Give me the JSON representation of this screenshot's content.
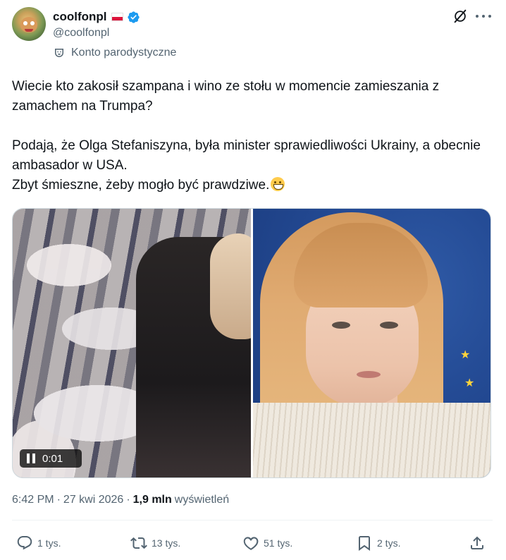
{
  "author": {
    "display_name": "coolfonpl",
    "handle": "@coolfonpl",
    "label": "Konto parodystyczne",
    "flag": "poland-flag",
    "verified": true
  },
  "header_icons": {
    "grok": "grok-icon",
    "more": "more-icon"
  },
  "text": {
    "para1": "Wiecie kto zakosił szampana i wino ze stołu w momencie zamieszania z zamachem na Trumpa?",
    "para2_line1": "Podają, że Olga Stefaniszyna, była minister sprawiedliwości Ukrainy, a obecnie ambasador w USA.",
    "para2_line2": "Zbyt śmieszne, żeby mogło być prawdziwe.",
    "emoji": "grinning-face-emoji"
  },
  "media": {
    "video_time": "0:01"
  },
  "meta": {
    "time": "6:42 PM",
    "separator": "·",
    "date": "27 kwi 2026",
    "views_count": "1,9 mln",
    "views_label": "wyświetleń"
  },
  "actions": {
    "replies": "1 tys.",
    "reposts": "13 tys.",
    "likes": "51 tys.",
    "bookmarks": "2 tys."
  },
  "colors": {
    "text_primary": "#0f1419",
    "text_secondary": "#536471",
    "verified_blue": "#1d9bf0",
    "border": "#cfd9de"
  }
}
